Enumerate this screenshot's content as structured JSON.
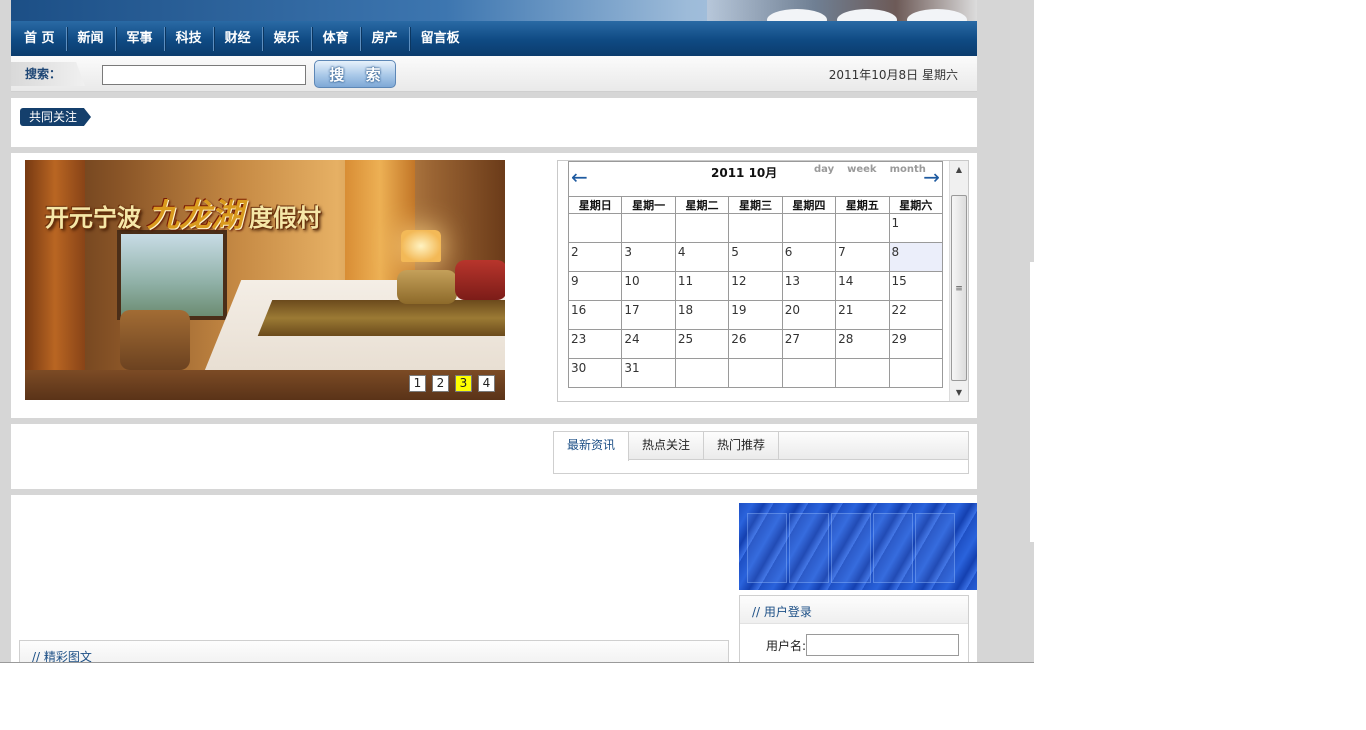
{
  "nav": {
    "items": [
      "首 页",
      "新闻",
      "军事",
      "科技",
      "财经",
      "娱乐",
      "体育",
      "房产",
      "留言板"
    ]
  },
  "search": {
    "label": "搜索：",
    "value": "",
    "button": "搜 索"
  },
  "date_text": "2011年10月8日 星期六",
  "focus": {
    "tag": "共同关注"
  },
  "slider": {
    "title_prefix": "开元宁波",
    "title_highlight": "九龙湖",
    "title_suffix": "度假村",
    "pages": [
      "1",
      "2",
      "3",
      "4"
    ],
    "active_page": 3
  },
  "calendar": {
    "title": "2011 10月",
    "prev": "←",
    "next": "→",
    "views": [
      "day",
      "week",
      "month"
    ],
    "weekdays": [
      "星期日",
      "星期一",
      "星期二",
      "星期三",
      "星期四",
      "星期五",
      "星期六"
    ],
    "weeks": [
      [
        "",
        "",
        "",
        "",
        "",
        "",
        "1"
      ],
      [
        "2",
        "3",
        "4",
        "5",
        "6",
        "7",
        "8"
      ],
      [
        "9",
        "10",
        "11",
        "12",
        "13",
        "14",
        "15"
      ],
      [
        "16",
        "17",
        "18",
        "19",
        "20",
        "21",
        "22"
      ],
      [
        "23",
        "24",
        "25",
        "26",
        "27",
        "28",
        "29"
      ],
      [
        "30",
        "31",
        "",
        "",
        "",
        "",
        ""
      ]
    ],
    "today": "8"
  },
  "tabs": {
    "items": [
      "最新资讯",
      "热点关注",
      "热门推荐"
    ],
    "active": 0
  },
  "photo_panel": {
    "title": "// 精彩图文"
  },
  "login": {
    "title": "// 用户登录",
    "username_label": "用户名:",
    "username_value": ""
  },
  "colors": {
    "nav_bg": "#0f4a83",
    "accent": "#1c4f86",
    "today_bg": "#ebeefa",
    "pager_active": "#ffff00"
  }
}
